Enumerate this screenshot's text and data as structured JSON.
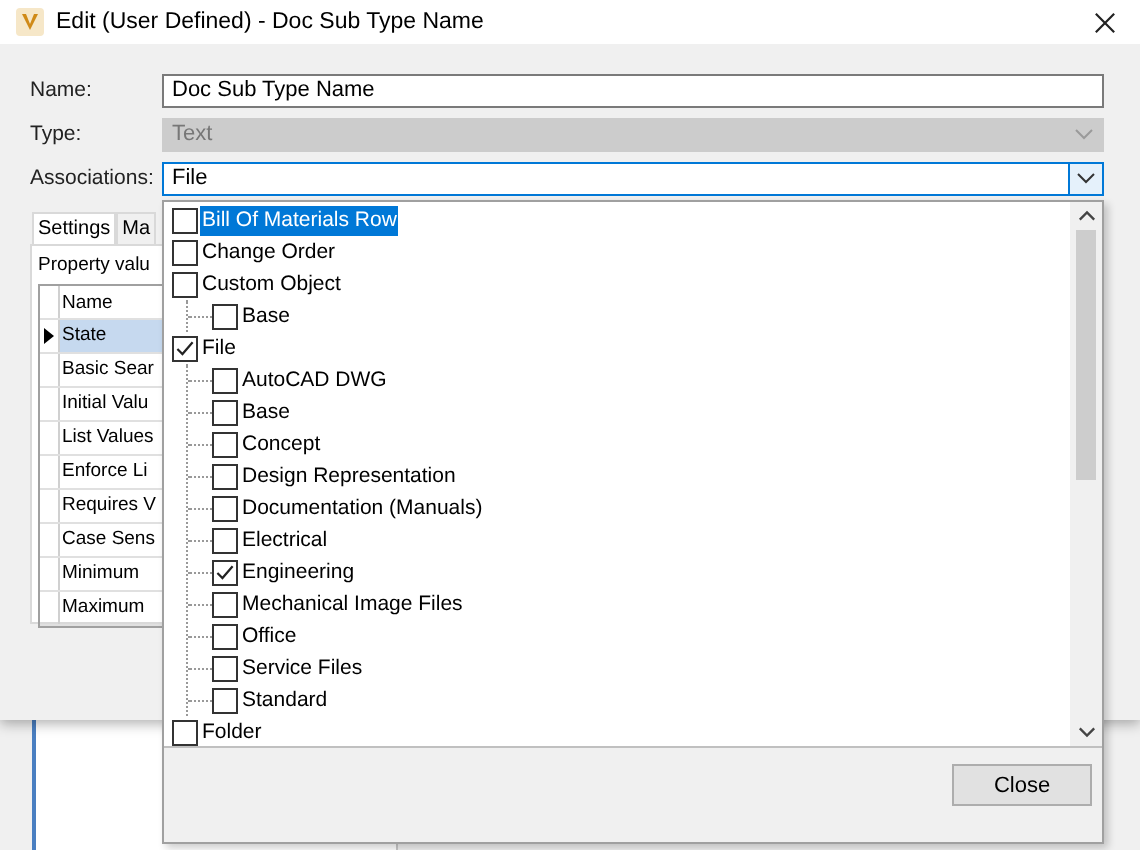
{
  "window": {
    "title": "Edit (User Defined) - Doc Sub Type Name"
  },
  "fields": [
    {
      "label": "Name:",
      "value": "Doc Sub Type Name",
      "disabled": false
    },
    {
      "label": "Type:",
      "value": "Text",
      "disabled": true
    }
  ],
  "associations": {
    "label": "Associations:",
    "value": "File"
  },
  "tabs": [
    {
      "label": "Settings",
      "selected": true
    },
    {
      "label": "Ma",
      "selected": false
    }
  ],
  "panel": {
    "caption": "Property valu",
    "column": "Name",
    "rows": [
      {
        "text": "State",
        "selected": true
      },
      {
        "text": "Basic Sear",
        "selected": false
      },
      {
        "text": "Initial Valu",
        "selected": false
      },
      {
        "text": "List Values",
        "selected": false
      },
      {
        "text": "Enforce Li",
        "selected": false
      },
      {
        "text": "Requires V",
        "selected": false
      },
      {
        "text": "Case Sens",
        "selected": false
      },
      {
        "text": "Minimum",
        "selected": false
      },
      {
        "text": "Maximum",
        "selected": false
      }
    ]
  },
  "dropdown": {
    "items": [
      {
        "label": "Bill Of Materials Row",
        "checked": false,
        "selected": true
      },
      {
        "label": "Change Order",
        "checked": false,
        "selected": false
      },
      {
        "label": "Custom Object",
        "checked": false,
        "selected": false,
        "children": [
          {
            "label": "Base",
            "checked": false,
            "selected": false
          }
        ]
      },
      {
        "label": "File",
        "checked": true,
        "selected": false,
        "children": [
          {
            "label": "AutoCAD DWG",
            "checked": false,
            "selected": false
          },
          {
            "label": "Base",
            "checked": false,
            "selected": false
          },
          {
            "label": "Concept",
            "checked": false,
            "selected": false
          },
          {
            "label": "Design Representation",
            "checked": false,
            "selected": false
          },
          {
            "label": "Documentation (Manuals)",
            "checked": false,
            "selected": false
          },
          {
            "label": "Electrical",
            "checked": false,
            "selected": false
          },
          {
            "label": "Engineering",
            "checked": true,
            "selected": false
          },
          {
            "label": "Mechanical Image Files",
            "checked": false,
            "selected": false
          },
          {
            "label": "Office",
            "checked": false,
            "selected": false
          },
          {
            "label": "Service Files",
            "checked": false,
            "selected": false
          },
          {
            "label": "Standard",
            "checked": false,
            "selected": false
          }
        ]
      },
      {
        "label": "Folder",
        "checked": false,
        "selected": false
      }
    ],
    "button": "Close"
  }
}
